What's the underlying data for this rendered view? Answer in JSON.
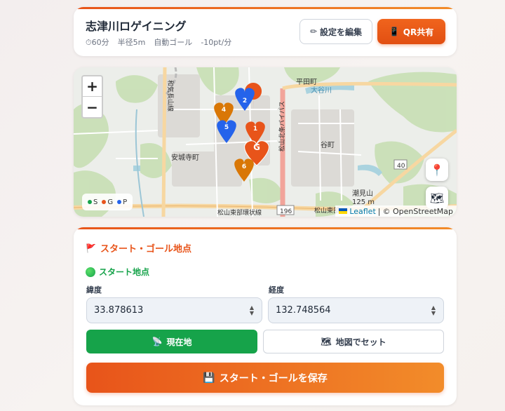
{
  "header": {
    "title": "志津川ロゲイニング",
    "meta": {
      "duration": "60分",
      "radius": "半径5m",
      "auto_goal": "自動ゴール",
      "penalty": "-10pt/分"
    },
    "edit_button": "設定を編集",
    "qr_button": "QR共有"
  },
  "map": {
    "zoom_in": "+",
    "zoom_out": "−",
    "labels": {
      "hirata": "平田町",
      "anjoji": "安城寺町",
      "tani": "谷町",
      "shiomi": "潮見山",
      "elev": "125 m",
      "road40": "40",
      "road196": "196",
      "matsuyama_east": "松山東部環状線",
      "matsuyama_east2": "松山東部",
      "bypass": "松山北条バイパス",
      "river": "大谷川",
      "wakayama": "和気長山線"
    },
    "markers": [
      "2",
      "4",
      "5",
      "1",
      "G",
      "6"
    ],
    "legend": {
      "s": "S",
      "g": "G",
      "p": "P"
    },
    "legend_colors": {
      "s": "#16a34a",
      "g": "#e8541a",
      "p": "#2563eb"
    },
    "attribution": {
      "leaflet": "Leaflet",
      "sep": "|",
      "osm": "© OpenStreetMap"
    }
  },
  "form": {
    "section_title": "スタート・ゴール地点",
    "start_title": "スタート地点",
    "lat_label": "緯度",
    "lng_label": "経度",
    "lat_value": "33.878613",
    "lng_value": "132.748564",
    "current_location_button": "現在地",
    "map_set_button": "地図でセット",
    "save_button": "スタート・ゴールを保存"
  },
  "colors": {
    "accent": "#e8541a",
    "green": "#16a34a",
    "blue": "#2563eb"
  }
}
